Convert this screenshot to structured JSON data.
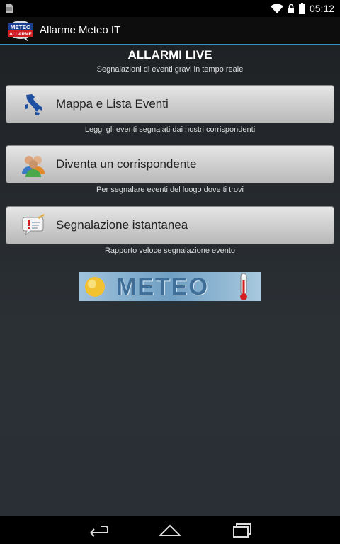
{
  "status_bar": {
    "time": "05:12"
  },
  "action_bar": {
    "title": "Allarme Meteo IT",
    "logo_text_top": "METEO",
    "logo_text_bottom": "ALLARME"
  },
  "header": {
    "title": "ALLARMI LIVE",
    "subtitle": "Segnalazioni di eventi gravi in tempo reale"
  },
  "menu": [
    {
      "label": "Mappa e Lista Eventi",
      "caption": "Leggi gli eventi segnalati dai nostri corrispondenti",
      "icon": "italy-map-icon"
    },
    {
      "label": "Diventa un corrispondente",
      "caption": "Per segnalare eventi del luogo dove ti trovi",
      "icon": "users-icon"
    },
    {
      "label": "Segnalazione istantanea",
      "caption": "Rapporto veloce segnalazione evento",
      "icon": "alert-message-icon"
    }
  ],
  "banner": {
    "text": "METEO"
  },
  "colors": {
    "accent": "#3a8fbf",
    "button_top": "#e6e6e6",
    "button_bottom": "#b9b9b9",
    "background": "#2b3035"
  }
}
